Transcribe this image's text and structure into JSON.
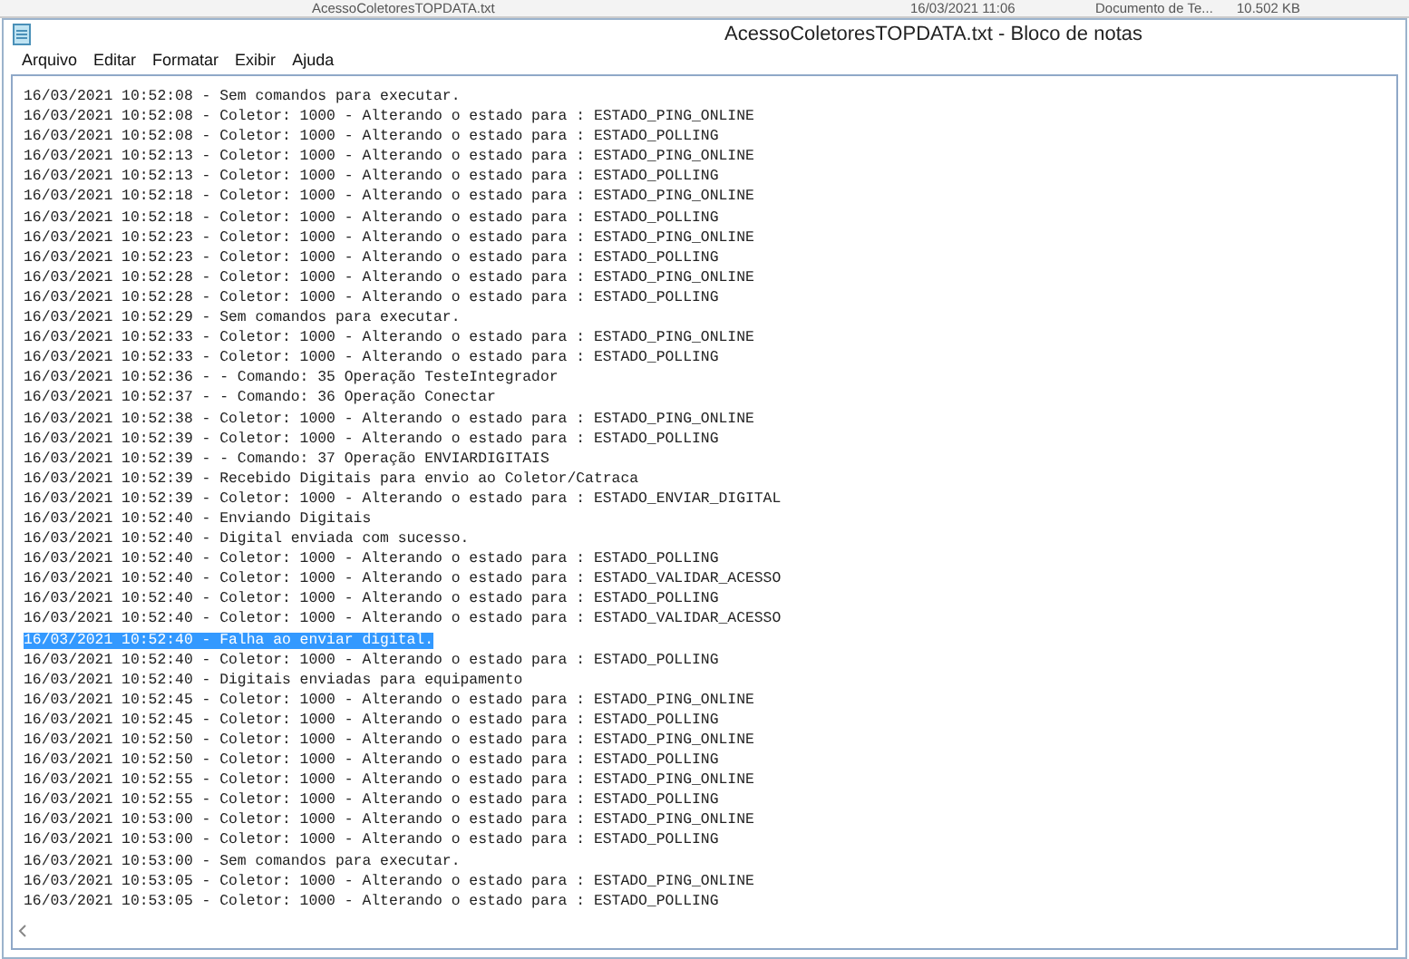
{
  "background_file_row": {
    "name": "AcessoColetoresTOPDATA.txt",
    "modified": "16/03/2021 11:06",
    "type": "Documento de Te...",
    "size": "10.502 KB"
  },
  "window": {
    "title": "AcessoColetoresTOPDATA.txt - Bloco de notas"
  },
  "menu": [
    "Arquivo",
    "Editar",
    "Formatar",
    "Exibir",
    "Ajuda"
  ],
  "lines": [
    {
      "text": "16/03/2021 10:52:08 - Sem comandos para executar.",
      "selected": false
    },
    {
      "text": "16/03/2021 10:52:08 - Coletor: 1000 - Alterando o estado para : ESTADO_PING_ONLINE",
      "selected": false
    },
    {
      "text": "16/03/2021 10:52:08 - Coletor: 1000 - Alterando o estado para : ESTADO_POLLING",
      "selected": false
    },
    {
      "text": "16/03/2021 10:52:13 - Coletor: 1000 - Alterando o estado para : ESTADO_PING_ONLINE",
      "selected": false
    },
    {
      "text": "16/03/2021 10:52:13 - Coletor: 1000 - Alterando o estado para : ESTADO_POLLING",
      "selected": false
    },
    {
      "text": "16/03/2021 10:52:18 - Coletor: 1000 - Alterando o estado para : ESTADO_PING_ONLINE",
      "selected": false
    },
    {
      "text": "16/03/2021 10:52:18 - Coletor: 1000 - Alterando o estado para : ESTADO_POLLING",
      "selected": false
    },
    {
      "text": "16/03/2021 10:52:23 - Coletor: 1000 - Alterando o estado para : ESTADO_PING_ONLINE",
      "selected": false
    },
    {
      "text": "16/03/2021 10:52:23 - Coletor: 1000 - Alterando o estado para : ESTADO_POLLING",
      "selected": false
    },
    {
      "text": "16/03/2021 10:52:28 - Coletor: 1000 - Alterando o estado para : ESTADO_PING_ONLINE",
      "selected": false
    },
    {
      "text": "16/03/2021 10:52:28 - Coletor: 1000 - Alterando o estado para : ESTADO_POLLING",
      "selected": false
    },
    {
      "text": "16/03/2021 10:52:29 - Sem comandos para executar.",
      "selected": false
    },
    {
      "text": "16/03/2021 10:52:33 - Coletor: 1000 - Alterando o estado para : ESTADO_PING_ONLINE",
      "selected": false
    },
    {
      "text": "16/03/2021 10:52:33 - Coletor: 1000 - Alterando o estado para : ESTADO_POLLING",
      "selected": false
    },
    {
      "text": "16/03/2021 10:52:36 - - Comando: 35 Operação TesteIntegrador",
      "selected": false
    },
    {
      "text": "16/03/2021 10:52:37 - - Comando: 36 Operação Conectar",
      "selected": false
    },
    {
      "text": "16/03/2021 10:52:38 - Coletor: 1000 - Alterando o estado para : ESTADO_PING_ONLINE",
      "selected": false
    },
    {
      "text": "16/03/2021 10:52:39 - Coletor: 1000 - Alterando o estado para : ESTADO_POLLING",
      "selected": false
    },
    {
      "text": "16/03/2021 10:52:39 - - Comando: 37 Operação ENVIARDIGITAIS",
      "selected": false
    },
    {
      "text": "16/03/2021 10:52:39 - Recebido Digitais para envio ao Coletor/Catraca",
      "selected": false
    },
    {
      "text": "16/03/2021 10:52:39 - Coletor: 1000 - Alterando o estado para : ESTADO_ENVIAR_DIGITAL",
      "selected": false
    },
    {
      "text": "16/03/2021 10:52:40 - Enviando Digitais",
      "selected": false
    },
    {
      "text": "16/03/2021 10:52:40 - Digital enviada com sucesso.",
      "selected": false
    },
    {
      "text": "16/03/2021 10:52:40 - Coletor: 1000 - Alterando o estado para : ESTADO_POLLING",
      "selected": false
    },
    {
      "text": "16/03/2021 10:52:40 - Coletor: 1000 - Alterando o estado para : ESTADO_VALIDAR_ACESSO",
      "selected": false
    },
    {
      "text": "16/03/2021 10:52:40 - Coletor: 1000 - Alterando o estado para : ESTADO_POLLING",
      "selected": false
    },
    {
      "text": "16/03/2021 10:52:40 - Coletor: 1000 - Alterando o estado para : ESTADO_VALIDAR_ACESSO",
      "selected": false
    },
    {
      "text": "16/03/2021 10:52:40 - Falha ao enviar digital.",
      "selected": true
    },
    {
      "text": "16/03/2021 10:52:40 - Coletor: 1000 - Alterando o estado para : ESTADO_POLLING",
      "selected": false
    },
    {
      "text": "16/03/2021 10:52:40 - Digitais enviadas para equipamento",
      "selected": false
    },
    {
      "text": "16/03/2021 10:52:45 - Coletor: 1000 - Alterando o estado para : ESTADO_PING_ONLINE",
      "selected": false
    },
    {
      "text": "16/03/2021 10:52:45 - Coletor: 1000 - Alterando o estado para : ESTADO_POLLING",
      "selected": false
    },
    {
      "text": "16/03/2021 10:52:50 - Coletor: 1000 - Alterando o estado para : ESTADO_PING_ONLINE",
      "selected": false
    },
    {
      "text": "16/03/2021 10:52:50 - Coletor: 1000 - Alterando o estado para : ESTADO_POLLING",
      "selected": false
    },
    {
      "text": "16/03/2021 10:52:55 - Coletor: 1000 - Alterando o estado para : ESTADO_PING_ONLINE",
      "selected": false
    },
    {
      "text": "16/03/2021 10:52:55 - Coletor: 1000 - Alterando o estado para : ESTADO_POLLING",
      "selected": false
    },
    {
      "text": "16/03/2021 10:53:00 - Coletor: 1000 - Alterando o estado para : ESTADO_PING_ONLINE",
      "selected": false
    },
    {
      "text": "16/03/2021 10:53:00 - Coletor: 1000 - Alterando o estado para : ESTADO_POLLING",
      "selected": false
    },
    {
      "text": "16/03/2021 10:53:00 - Sem comandos para executar.",
      "selected": false
    },
    {
      "text": "16/03/2021 10:53:05 - Coletor: 1000 - Alterando o estado para : ESTADO_PING_ONLINE",
      "selected": false
    },
    {
      "text": "16/03/2021 10:53:05 - Coletor: 1000 - Alterando o estado para : ESTADO_POLLING",
      "selected": false
    }
  ]
}
